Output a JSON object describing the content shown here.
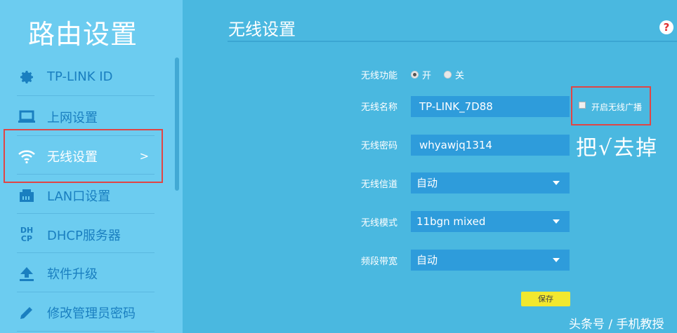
{
  "sidebar": {
    "brand": "路由设置",
    "items": [
      {
        "label": "TP-LINK ID",
        "icon": "gear-icon"
      },
      {
        "label": "上网设置",
        "icon": "laptop-icon"
      },
      {
        "label": "无线设置",
        "icon": "wifi-icon",
        "active": true,
        "arrow": ">"
      },
      {
        "label": "LAN口设置",
        "icon": "lan-port-icon"
      },
      {
        "label": "DHCP服务器",
        "icon": "dhcp-icon",
        "icon_text_top": "DH",
        "icon_text_bottom": "CP"
      },
      {
        "label": "软件升级",
        "icon": "upload-icon"
      },
      {
        "label": "修改管理员密码",
        "icon": "pencil-icon"
      }
    ]
  },
  "main": {
    "title": "无线设置",
    "help": "?",
    "form": {
      "wireless_function": {
        "label": "无线功能",
        "options": [
          "开",
          "关"
        ],
        "selected": "开"
      },
      "ssid": {
        "label": "无线名称",
        "value": "TP-LINK_7D88"
      },
      "broadcast": {
        "label": "开启无线广播",
        "checked": false
      },
      "password": {
        "label": "无线密码",
        "value": "whyawjq1314"
      },
      "channel": {
        "label": "无线信道",
        "value": "自动"
      },
      "mode": {
        "label": "无线模式",
        "value": "11bgn mixed"
      },
      "bandwidth": {
        "label": "频段带宽",
        "value": "自动"
      },
      "save_label": "保存"
    },
    "annotation": "把√去掉",
    "watermark": "头条号 / 手机教授"
  },
  "colors": {
    "sidebar_bg": "#6cccf0",
    "main_bg": "#4ab8e0",
    "field_bg": "#2e9cdb",
    "nav_text": "#1a7fc0",
    "highlight": "#e04545",
    "save_button": "#f2e82e"
  }
}
